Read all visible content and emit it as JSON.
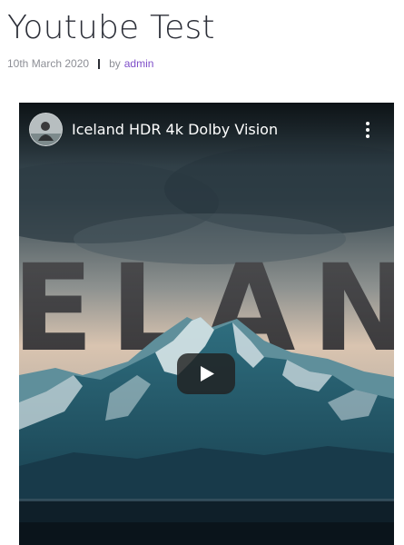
{
  "post": {
    "title": "Youtube Test",
    "date": "10th March 2020",
    "by_label": "by",
    "author": "admin",
    "author_color": "#7f4fc9"
  },
  "video": {
    "title": "Iceland HDR 4k Dolby Vision",
    "overlay_text": "ELAN",
    "play_icon": "play-icon",
    "menu_icon": "more-vertical-icon"
  }
}
